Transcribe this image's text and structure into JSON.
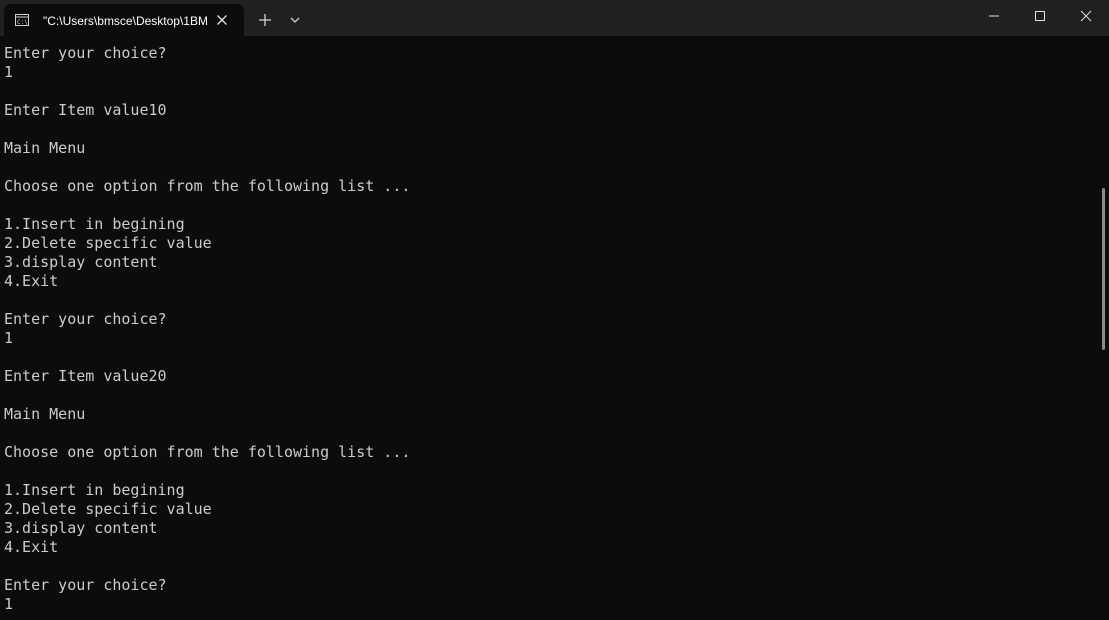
{
  "tab": {
    "title": "\"C:\\Users\\bmsce\\Desktop\\1BM"
  },
  "console": {
    "lines": [
      "Enter your choice?",
      "1",
      "",
      "Enter Item value10",
      "",
      "Main Menu",
      "",
      "Choose one option from the following list ...",
      "",
      "1.Insert in begining",
      "2.Delete specific value",
      "3.display content",
      "4.Exit",
      "",
      "Enter your choice?",
      "1",
      "",
      "Enter Item value20",
      "",
      "Main Menu",
      "",
      "Choose one option from the following list ...",
      "",
      "1.Insert in begining",
      "2.Delete specific value",
      "3.display content",
      "4.Exit",
      "",
      "Enter your choice?",
      "1"
    ]
  },
  "icons": {
    "app": "terminal-icon",
    "close_tab": "close-icon",
    "new_tab": "plus-icon",
    "dropdown": "chevron-down-icon",
    "minimize": "minimize-icon",
    "maximize": "maximize-icon",
    "close_window": "close-icon"
  },
  "colors": {
    "background": "#0c0c0c",
    "titlebar": "#202020",
    "text": "#cccccc"
  }
}
